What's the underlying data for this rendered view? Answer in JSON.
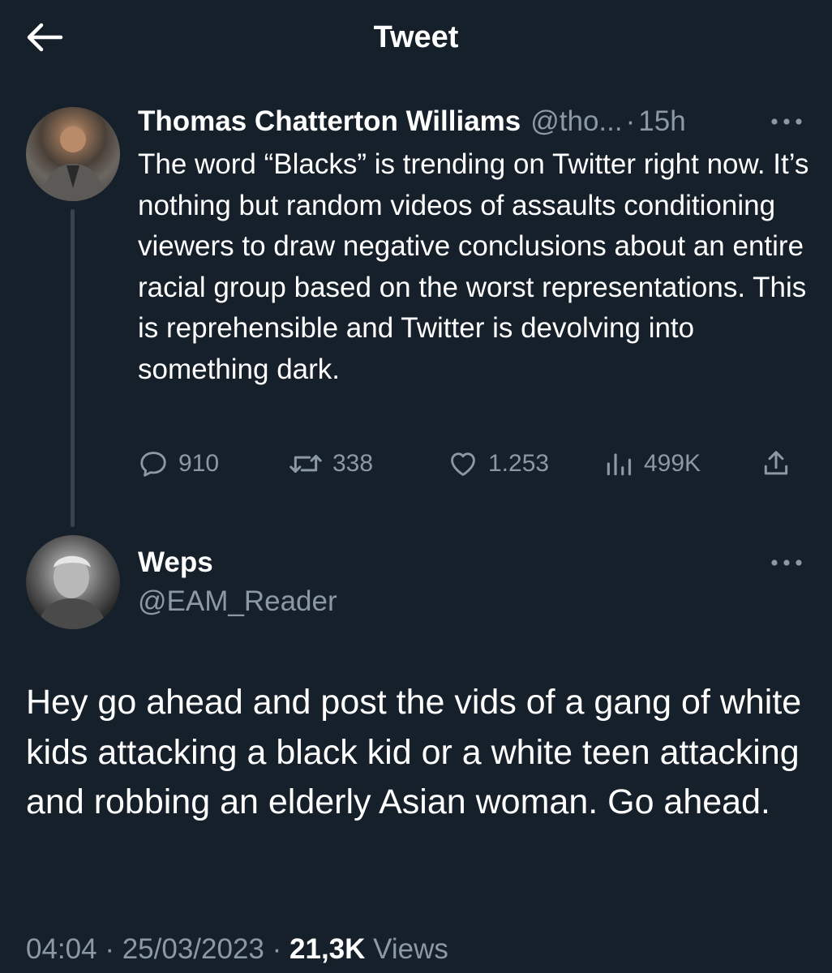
{
  "header": {
    "title": "Tweet",
    "back_icon": "arrow-left-icon"
  },
  "parent_tweet": {
    "author_name": "Thomas Chatterton Williams",
    "handle": "@tho...",
    "separator": "·",
    "time": "15h",
    "text": "The word “Blacks” is trending on Twitter right now. It’s nothing but random videos of assaults conditioning viewers to draw negative conclusions about an entire racial group based on the worst representations. This is reprehensible and Twitter is devolving into something dark.",
    "replies": "910",
    "retweets": "338",
    "likes": "1.253",
    "views": "499K"
  },
  "reply_tweet": {
    "author_name": "Weps",
    "handle": "@EAM_Reader",
    "text": "Hey go ahead and post the vids of a gang of white kids attacking a black kid or a white teen attacking and robbing an elderly Asian woman. Go ahead.",
    "time": "04:04",
    "date": "25/03/2023",
    "separator": "·",
    "views_count": "21,3K",
    "views_label": "Views"
  },
  "colors": {
    "background": "#15202b",
    "text_primary": "#ffffff",
    "text_secondary": "#8b98a5",
    "thread_line": "#38444d"
  }
}
